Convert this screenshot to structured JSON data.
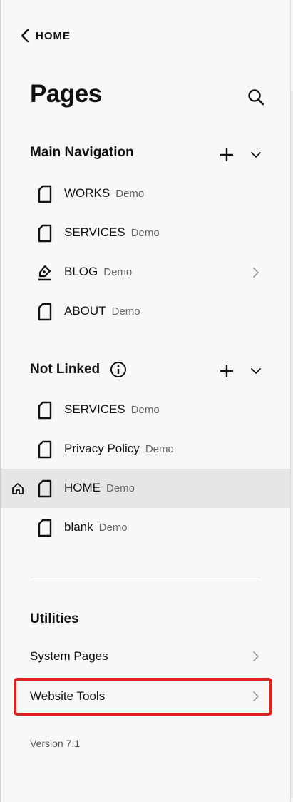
{
  "nav": {
    "back_label": "HOME"
  },
  "header": {
    "title": "Pages"
  },
  "main_navigation": {
    "heading": "Main Navigation",
    "items": [
      {
        "label": "WORKS",
        "badge": "Demo",
        "icon": "page-icon"
      },
      {
        "label": "SERVICES",
        "badge": "Demo",
        "icon": "page-icon"
      },
      {
        "label": "BLOG",
        "badge": "Demo",
        "icon": "blog-icon"
      },
      {
        "label": "ABOUT",
        "badge": "Demo",
        "icon": "page-icon"
      }
    ]
  },
  "not_linked": {
    "heading": "Not Linked",
    "items": [
      {
        "label": "SERVICES",
        "badge": "Demo",
        "icon": "page-icon"
      },
      {
        "label": "Privacy Policy",
        "badge": "Demo",
        "icon": "page-icon"
      },
      {
        "label": "HOME",
        "badge": "Demo",
        "icon": "page-icon",
        "is_homepage": true,
        "selected": true
      },
      {
        "label": "blank",
        "badge": "Demo",
        "icon": "page-icon"
      }
    ]
  },
  "utilities": {
    "heading": "Utilities",
    "items": [
      {
        "label": "System Pages"
      },
      {
        "label": "Website Tools",
        "highlighted": true
      }
    ]
  },
  "footer": {
    "version": "Version 7.1"
  },
  "colors": {
    "highlight_border": "#e0201b",
    "selected_row": "#e6e6e6",
    "background": "#f8f8f8"
  }
}
